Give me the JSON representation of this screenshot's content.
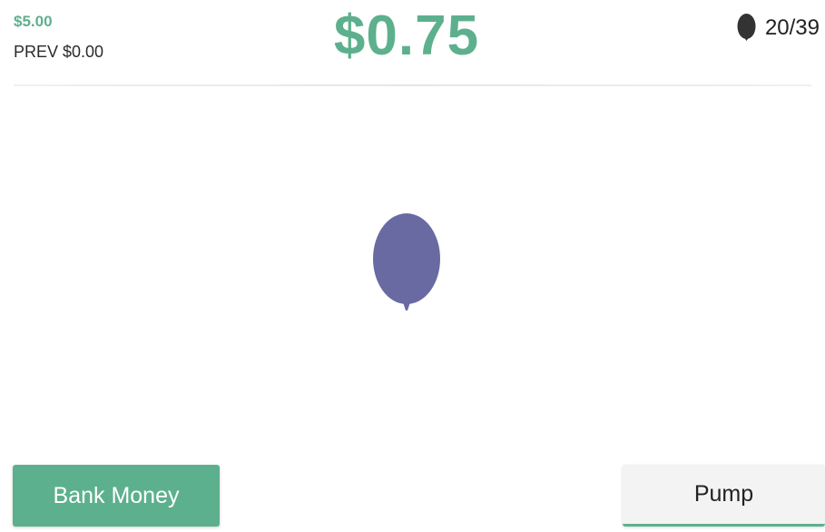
{
  "header": {
    "total_earned": "$5.00",
    "previous_earned": "PREV $0.00",
    "current_amount": "$0.75",
    "balloon_counter": "20/39",
    "counter_icon": "balloon-icon"
  },
  "balloon": {
    "color": "#6a6aa2"
  },
  "controls": {
    "bank_label": "Bank Money",
    "pump_label": "Pump"
  },
  "colors": {
    "accent": "#5db08e",
    "balloon": "#6a6aa2",
    "text": "#222222"
  }
}
